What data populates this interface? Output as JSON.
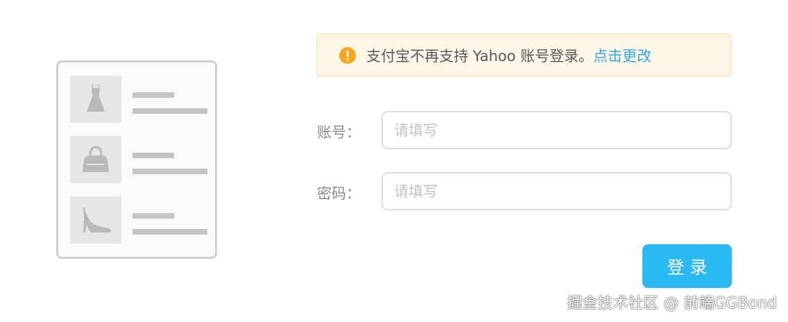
{
  "illustration": {
    "items": [
      {
        "icon": "dress-icon"
      },
      {
        "icon": "handbag-icon"
      },
      {
        "icon": "high-heel-icon"
      }
    ]
  },
  "notice": {
    "icon": "warning-icon",
    "text": "支付宝不再支持 Yahoo 账号登录。",
    "link": "点击更改",
    "color_bg": "#fdf6e6",
    "color_icon": "#f5a623",
    "color_link": "#2aa9e6"
  },
  "form": {
    "account": {
      "label": "账号：",
      "placeholder": "请填写"
    },
    "password": {
      "label": "密码：",
      "placeholder": "请填写"
    },
    "submit_label": "登录",
    "submit_color": "#2bb9f3"
  },
  "watermark": "掘金技术社区 @ 前端GGBond"
}
